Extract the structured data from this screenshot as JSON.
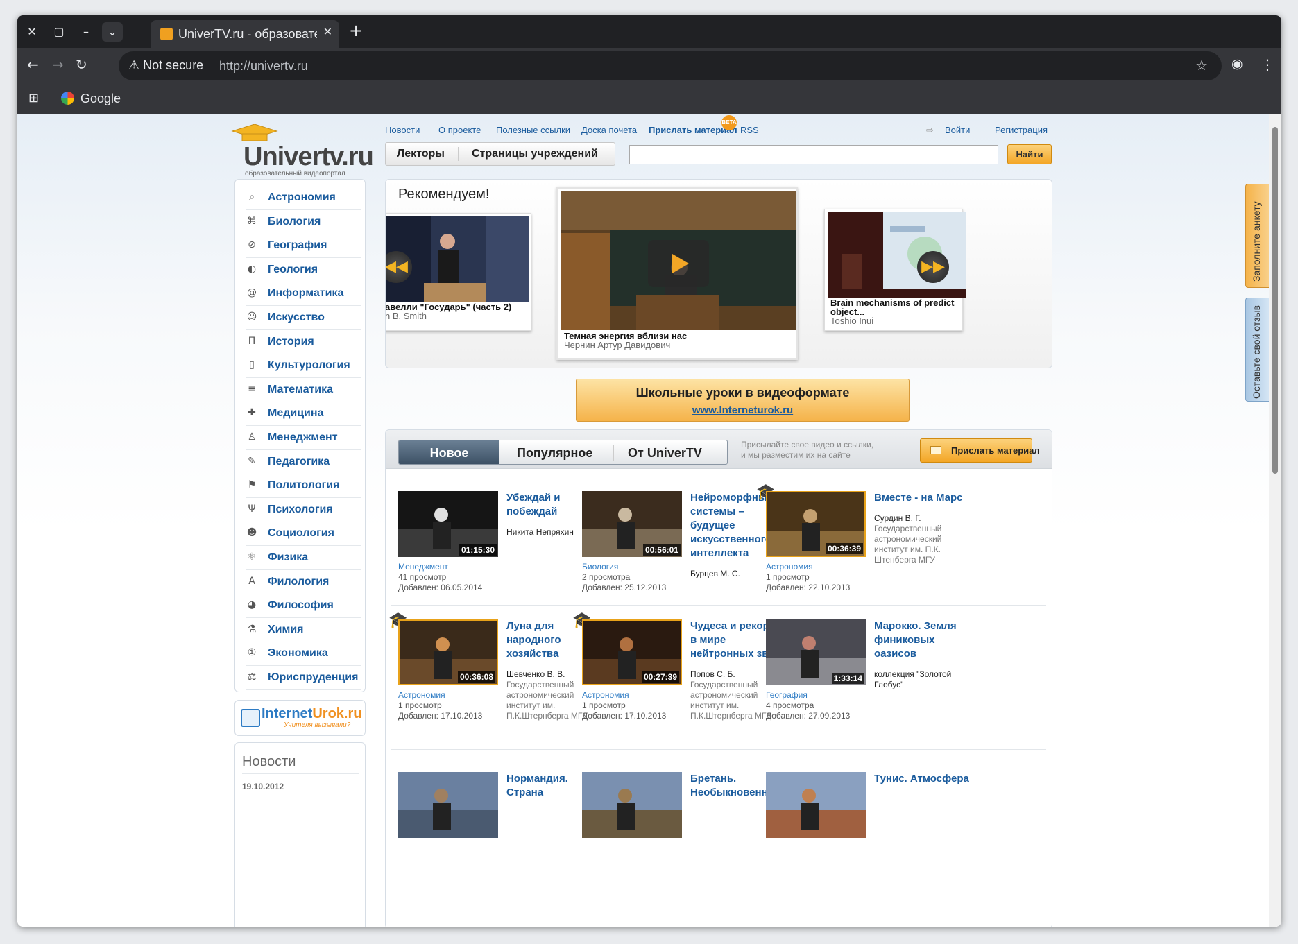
{
  "browser": {
    "tab_title": "UniverTV.ru - образовательный",
    "not_secure": "Not secure",
    "url": "http://univertv.ru",
    "bookmark_google": "Google"
  },
  "logo": {
    "word": "Univertv.ru",
    "sub": "образовательный видеопортал"
  },
  "topnav": {
    "news": "Новости",
    "about": "О проекте",
    "links": "Полезные ссылки",
    "honor": "Доска почета",
    "send": "Прислать материал",
    "beta": "BETA",
    "rss": "RSS",
    "login": "Войти",
    "register": "Регистрация"
  },
  "subtabs": {
    "lecturers": "Лекторы",
    "institutions": "Страницы учреждений"
  },
  "search": {
    "placeholder": "",
    "button": "Найти"
  },
  "categories": [
    {
      "icon": "telescope-icon",
      "glyph": "⌕",
      "label": "Астрономия"
    },
    {
      "icon": "dna-icon",
      "glyph": "⌘",
      "label": "Биология"
    },
    {
      "icon": "compass-icon",
      "glyph": "⊘",
      "label": "География"
    },
    {
      "icon": "rock-icon",
      "glyph": "◐",
      "label": "Геология"
    },
    {
      "icon": "at-icon",
      "glyph": "@",
      "label": "Информатика"
    },
    {
      "icon": "mask-icon",
      "glyph": "☺",
      "label": "Искусство"
    },
    {
      "icon": "column-icon",
      "glyph": "Π",
      "label": "История"
    },
    {
      "icon": "book-icon",
      "glyph": "▯",
      "label": "Культурология"
    },
    {
      "icon": "abacus-icon",
      "glyph": "≡",
      "label": "Математика"
    },
    {
      "icon": "cross-icon",
      "glyph": "✚",
      "label": "Медицина"
    },
    {
      "icon": "person-icon",
      "glyph": "♙",
      "label": "Менеджмент"
    },
    {
      "icon": "teacher-icon",
      "glyph": "✎",
      "label": "Педагогика"
    },
    {
      "icon": "flag-icon",
      "glyph": "⚑",
      "label": "Политология"
    },
    {
      "icon": "psi-icon",
      "glyph": "Ψ",
      "label": "Психология"
    },
    {
      "icon": "people-icon",
      "glyph": "☻",
      "label": "Социология"
    },
    {
      "icon": "atom-icon",
      "glyph": "⚛",
      "label": "Физика"
    },
    {
      "icon": "letter-a-icon",
      "glyph": "A",
      "label": "Филология"
    },
    {
      "icon": "globe-icon",
      "glyph": "◕",
      "label": "Философия"
    },
    {
      "icon": "flask-icon",
      "glyph": "⚗",
      "label": "Химия"
    },
    {
      "icon": "coin-icon",
      "glyph": "①",
      "label": "Экономика"
    },
    {
      "icon": "scales-icon",
      "glyph": "⚖",
      "label": "Юриспруденция"
    }
  ],
  "internet_urok": {
    "name_a": "Internet",
    "name_b": "Urok.ru",
    "slogan": "Учителя вызывали?"
  },
  "news_box": {
    "title": "Новости",
    "date": "19.10.2012"
  },
  "recommend": {
    "title": "Рекомендуем!",
    "left": {
      "title": "авелли \"Государь\" (часть 2)",
      "author": "n B. Smith"
    },
    "center": {
      "title": "Темная энергия вблизи нас",
      "author": "Чернин Артур Давидович"
    },
    "right": {
      "title": "Brain mechanisms of predict",
      "title2": "object...",
      "author": "Toshio Inui"
    }
  },
  "banner": {
    "title": "Школьные уроки в видеоформате",
    "link": "www.Interneturok.ru"
  },
  "feed": {
    "tabs": [
      "Новое",
      "Популярное",
      "От UniverTV"
    ],
    "note": "Присылайте свое видео и ссылки, и мы разместим их на сайте",
    "send_button": "Прислать материал",
    "videos": [
      {
        "title": "Убеждай и побеждай",
        "author": "Никита Непряхин",
        "org": "",
        "duration": "01:15:30",
        "category": "Менеджмент",
        "views": "41 просмотр",
        "added": "Добавлен: 06.05.2014",
        "gold": false
      },
      {
        "title": "Нейроморфные системы – будущее искусственного интеллекта",
        "author": "Бурцев М. С.",
        "org": "",
        "duration": "00:56:01",
        "category": "Биология",
        "views": "2 просмотра",
        "added": "Добавлен: 25.12.2013",
        "gold": false
      },
      {
        "title": "Вместе - на Марс",
        "author": "Сурдин В. Г.",
        "org": "Государственный астрономический институт им. П.К. Штенберга МГУ",
        "duration": "00:36:39",
        "category": "Астрономия",
        "views": "1 просмотр",
        "added": "Добавлен: 22.10.2013",
        "gold": true
      },
      {
        "title": "Луна для народного хозяйства",
        "author": "Шевченко В. В.",
        "org": "Государственный астрономический институт им. П.К.Штернберга МГУ",
        "duration": "00:36:08",
        "category": "Астрономия",
        "views": "1 просмотр",
        "added": "Добавлен: 17.10.2013",
        "gold": true
      },
      {
        "title": "Чудеса и рекорды в мире нейтронных звезд",
        "author": "Попов С. Б.",
        "org": "Государственный астрономический институт им. П.К.Штернберга МГУ",
        "duration": "00:27:39",
        "category": "Астрономия",
        "views": "1 просмотр",
        "added": "Добавлен: 17.10.2013",
        "gold": true
      },
      {
        "title": "Марокко. Земля финиковых оазисов",
        "author": "коллекция \"Золотой Глобус\"",
        "org": "",
        "duration": "1:33:14",
        "category": "География",
        "views": "4 просмотра",
        "added": "Добавлен: 27.09.2013",
        "gold": false
      },
      {
        "title": "Нормандия. Страна",
        "author": "",
        "org": "",
        "duration": "",
        "category": "",
        "views": "",
        "added": "",
        "gold": false
      },
      {
        "title": "Бретань. Необыкновенные",
        "author": "",
        "org": "",
        "duration": "",
        "category": "",
        "views": "",
        "added": "",
        "gold": false
      },
      {
        "title": "Тунис. Атмосфера",
        "author": "",
        "org": "",
        "duration": "",
        "category": "",
        "views": "",
        "added": "",
        "gold": false
      }
    ]
  },
  "side_tabs": {
    "survey": "Заполните анкету",
    "feedback": "Оставьте свой отзыв"
  },
  "colors": {
    "link": "#1a5b9d",
    "accent": "#f3a626",
    "gold_border": "#e8a21a"
  }
}
